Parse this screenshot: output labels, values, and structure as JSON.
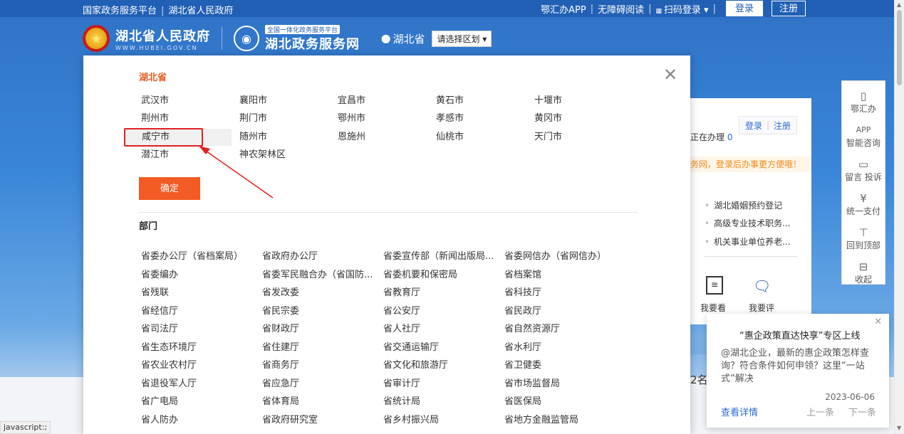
{
  "topbar": {
    "left_links": [
      "国家政务服务平台",
      "湖北省人民政府"
    ],
    "right_links": [
      "鄂汇办APP",
      "无障碍阅读",
      "扫码登录"
    ],
    "login": "登录",
    "register": "注册",
    "sep": "|"
  },
  "header": {
    "gov_name": "湖北省人民政府",
    "gov_url": "WWW.HUBEI.GOV.CN",
    "svc_badge": "全国一体化政务服务平台",
    "svc_name": "湖北政务服务网",
    "location": "湖北省",
    "region_select": "请选择区划"
  },
  "modal": {
    "province": "湖北省",
    "cities": [
      [
        "武汉市",
        "襄阳市",
        "宜昌市",
        "黄石市",
        "十堰市"
      ],
      [
        "荆州市",
        "荆门市",
        "鄂州市",
        "孝感市",
        "黄冈市"
      ],
      [
        "咸宁市",
        "随州市",
        "恩施州",
        "仙桃市",
        "天门市"
      ],
      [
        "潜江市",
        "神农架林区"
      ]
    ],
    "selected_city": "咸宁市",
    "confirm": "确定",
    "dept_title": "部门",
    "departments": [
      [
        "省委办公厅（省档案局）",
        "省政府办公厅",
        "省委宣传部（新闻出版局...",
        "省委网信办（省网信办）"
      ],
      [
        "省委编办",
        "省委军民融合办（省国防...",
        "省委机要和保密局",
        "省档案馆"
      ],
      [
        "省残联",
        "省发改委",
        "省教育厅",
        "省科技厅"
      ],
      [
        "省经信厅",
        "省民宗委",
        "省公安厅",
        "省民政厅"
      ],
      [
        "省司法厅",
        "省财政厅",
        "省人社厅",
        "省自然资源厅"
      ],
      [
        "省生态环境厅",
        "省住建厅",
        "省交通运输厅",
        "省水利厅"
      ],
      [
        "省农业农村厅",
        "省商务厅",
        "省文化和旅游厅",
        "省卫健委"
      ],
      [
        "省退役军人厅",
        "省应急厅",
        "省审计厅",
        "省市场监督局"
      ],
      [
        "省广电局",
        "省体育局",
        "省统计局",
        "省医保局"
      ],
      [
        "省人防办",
        "省政府研究室",
        "省乡村振兴局",
        "省地方金融监管局"
      ]
    ]
  },
  "behind": {
    "in_progress": "正在办理",
    "in_progress_count": "0",
    "login": "登录",
    "register": "注册",
    "notice": "务网，登录后办事更方便哦！",
    "hot_items": [
      "湖北婚姻预约登记",
      "高级专业技术职务...",
      "机关事业单位养老..."
    ],
    "see": "我要看",
    "rate": "我要评",
    "partial": "2名"
  },
  "sidebar": [
    {
      "icon": "phone-icon",
      "label": "鄂汇办"
    },
    {
      "icon": "robot-icon",
      "label": "智能咨询"
    },
    {
      "icon": "message-icon",
      "label": "留言 投诉"
    },
    {
      "icon": "yuan-icon",
      "label": "统一支付"
    },
    {
      "icon": "top-icon",
      "label": "回到顶部"
    },
    {
      "icon": "collapse-icon",
      "label": "收起"
    }
  ],
  "sidebar_app_label": "APP",
  "popup": {
    "title": "“惠企政策直达快享”专区上线",
    "body": "@湖北企业，最新的惠企政策怎样查询？符合条件如何申领？这里“一站式”解决",
    "date": "2023-06-06",
    "detail": "查看详情",
    "prev": "上一条",
    "next": "下一条"
  },
  "status_text": "javascript:;",
  "colors": {
    "accent": "#f25b23",
    "brand": "#2160b5",
    "highlight": "#e02020"
  }
}
